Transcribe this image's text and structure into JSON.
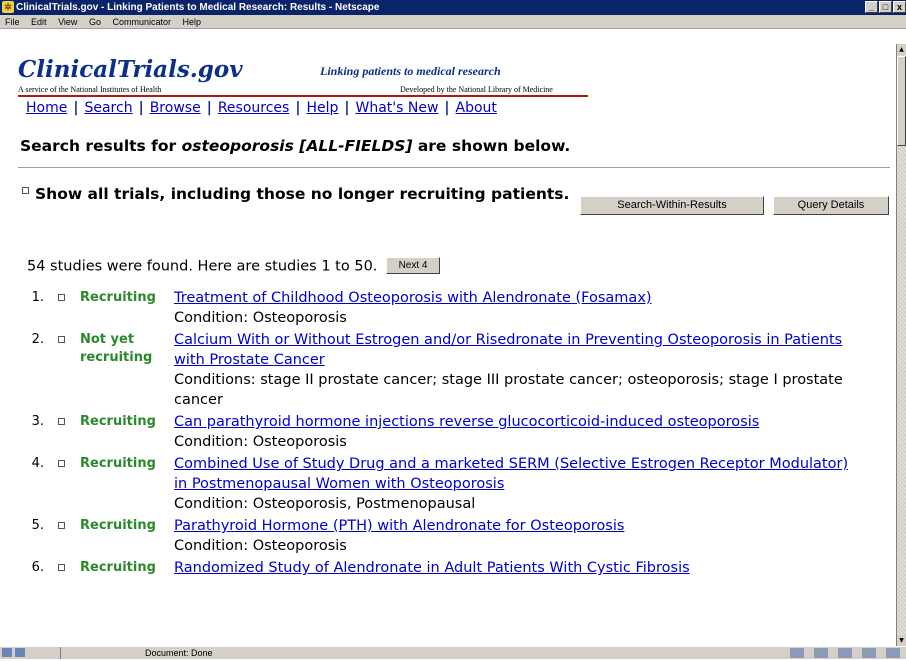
{
  "window": {
    "title": "ClinicalTrials.gov - Linking Patients to Medical Research: Results - Netscape",
    "controls": [
      "_",
      "□",
      "x"
    ]
  },
  "menubar": [
    "File",
    "Edit",
    "View",
    "Go",
    "Communicator",
    "Help"
  ],
  "header": {
    "logo": "ClinicalTrials.gov",
    "logo_sub": "A service of the National Institutes of Health",
    "tagline": "Linking patients to medical research",
    "tagline_sub": "Developed by the National Library of Medicine"
  },
  "nav": {
    "home": "Home",
    "search": "Search",
    "browse": "Browse",
    "resources": "Resources",
    "help": "Help",
    "whats_new": "What's New",
    "about": "About",
    "separator": "|"
  },
  "search": {
    "prefix": "Search results for ",
    "term": "osteoporosis [ALL-FIELDS]",
    "suffix": " are shown below."
  },
  "show_all_label": "Show all trials, including those no longer recruiting patients.",
  "buttons": {
    "search_within": "Search-Within-Results",
    "query_details": "Query Details",
    "next": "Next 4"
  },
  "found_text": "54 studies were found. Here are studies 1 to 50.",
  "results": [
    {
      "num": "1.",
      "status": "Recruiting",
      "title": "Treatment of Childhood Osteoporosis with Alendronate (Fosamax)",
      "condition": "Condition: Osteoporosis"
    },
    {
      "num": "2.",
      "status": "Not yet recruiting",
      "title": "Calcium With or Without Estrogen and/or Risedronate in Preventing Osteoporosis in Patients with Prostate Cancer",
      "condition": "Conditions: stage II prostate cancer; stage III prostate cancer; osteoporosis; stage I prostate cancer"
    },
    {
      "num": "3.",
      "status": "Recruiting",
      "title": "Can parathyroid hormone injections reverse glucocorticoid-induced osteoporosis",
      "condition": "Condition: Osteoporosis"
    },
    {
      "num": "4.",
      "status": "Recruiting",
      "title": "Combined Use of Study Drug and a marketed SERM (Selective Estrogen Receptor Modulator) in Postmenopausal Women with Osteoporosis",
      "condition": "Condition: Osteoporosis, Postmenopausal"
    },
    {
      "num": "5.",
      "status": "Recruiting",
      "title": "Parathyroid Hormone (PTH) with Alendronate for Osteoporosis",
      "condition": "Condition: Osteoporosis"
    },
    {
      "num": "6.",
      "status": "Recruiting",
      "title": "Randomized Study of Alendronate in Adult Patients With Cystic Fibrosis",
      "condition": ""
    }
  ],
  "statusbar": {
    "text": "Document: Done"
  }
}
